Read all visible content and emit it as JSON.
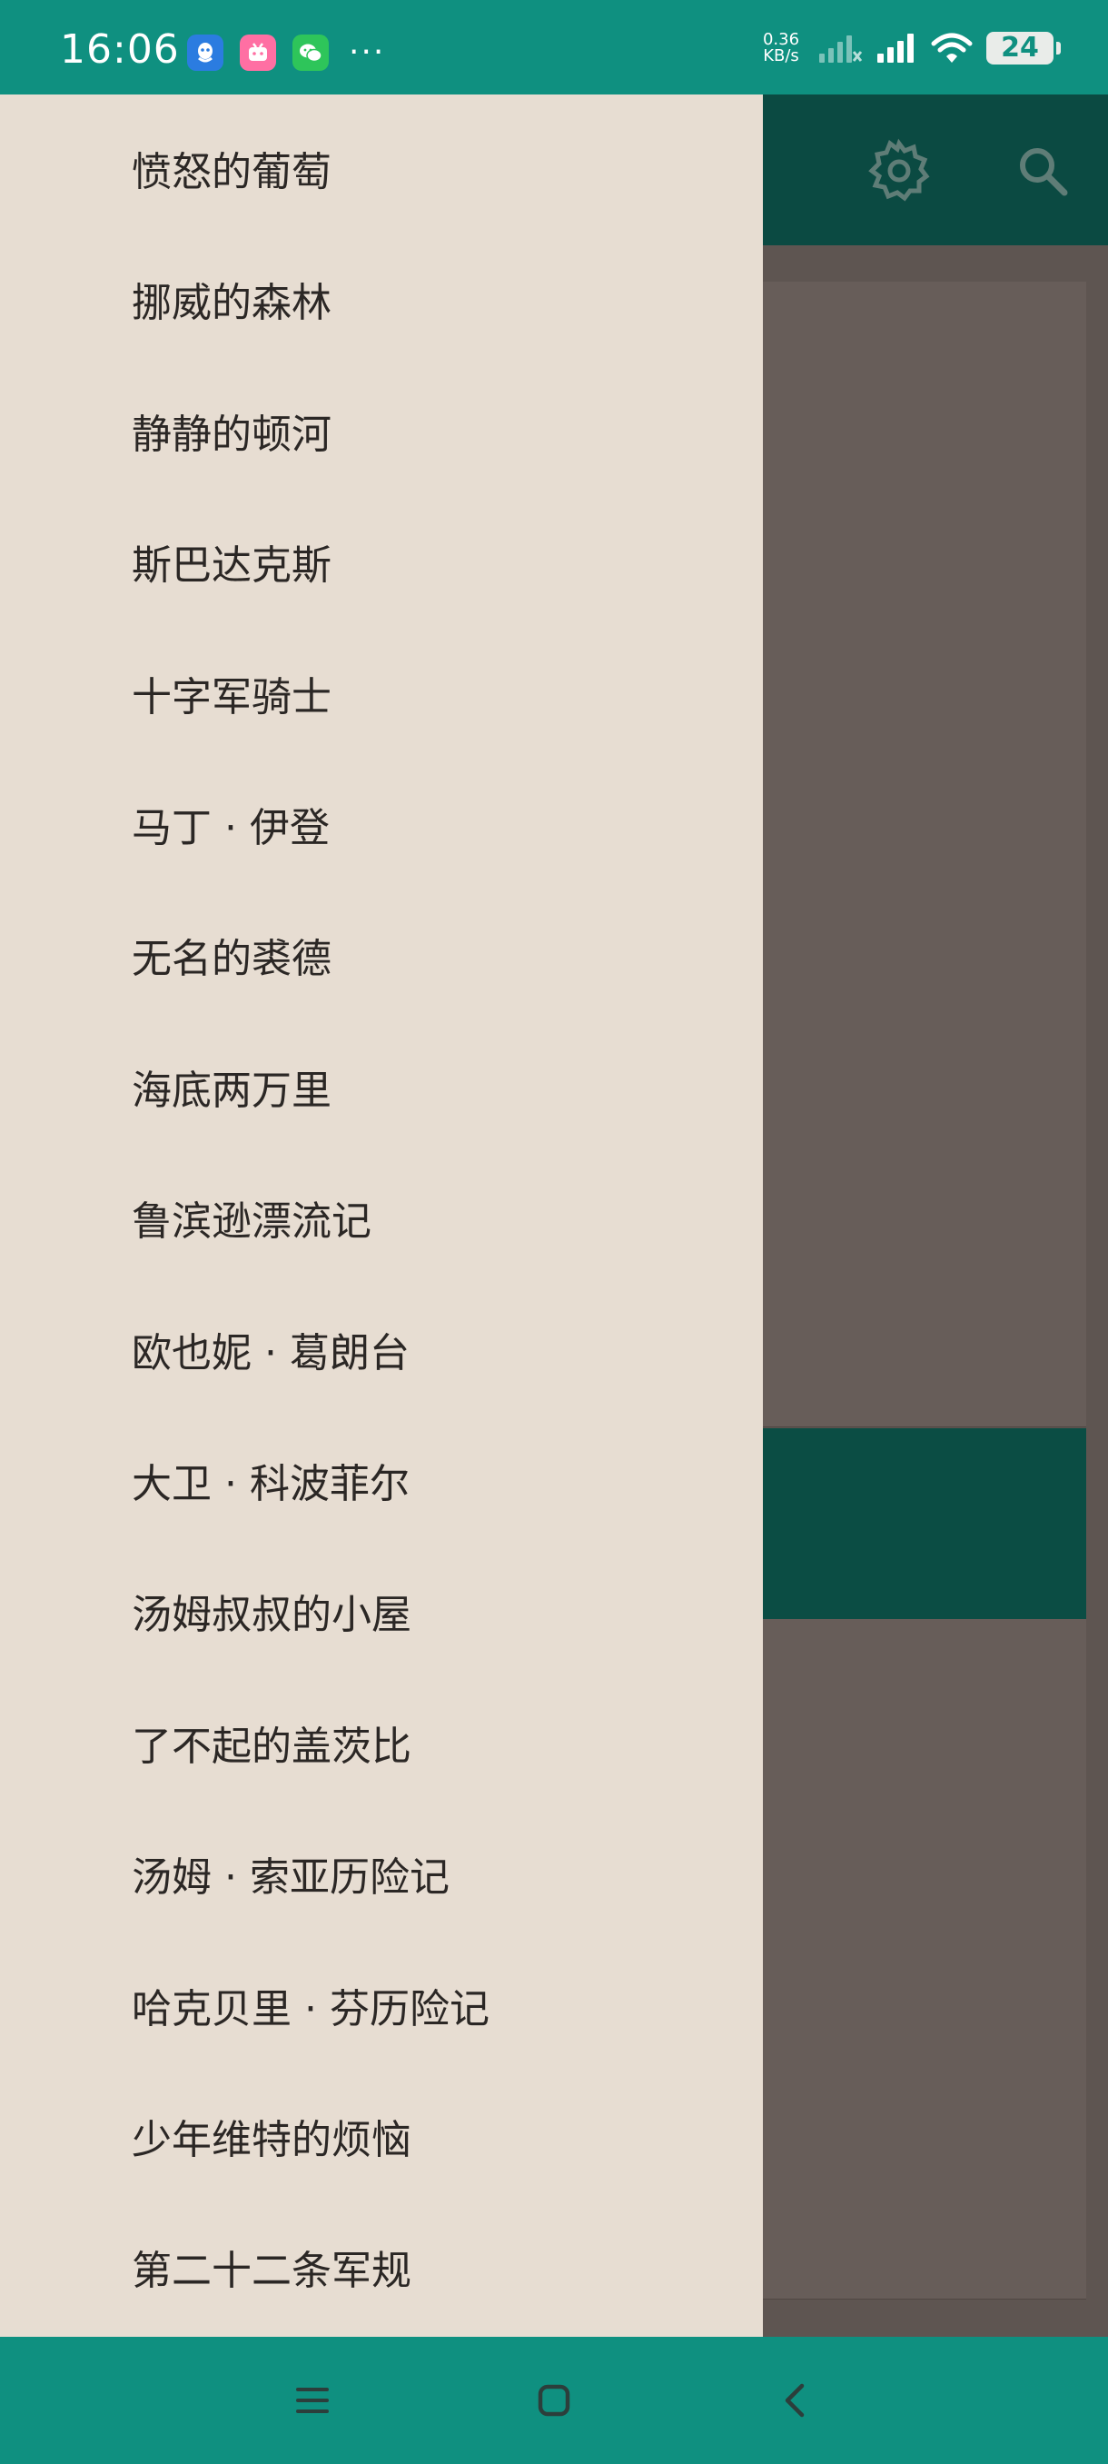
{
  "status_bar": {
    "time": "16:06",
    "net_speed_value": "0.36",
    "net_speed_unit": "KB/s",
    "battery": "24",
    "more": "···"
  },
  "icons": {
    "gear": "gear-icon",
    "search": "search-icon",
    "menu": "menu-icon",
    "home": "home-icon",
    "back": "back-icon"
  },
  "colors": {
    "status_bar": "#0f9080",
    "toolbar": "#0b4a42",
    "drawer": "#e7ddd2"
  },
  "drawer": {
    "items": [
      "愤怒的葡萄",
      "挪威的森林",
      "静静的顿河",
      "斯巴达克斯",
      "十字军骑士",
      "马丁 · 伊登",
      "无名的裘德",
      "海底两万里",
      "鲁滨逊漂流记",
      "欧也妮 · 葛朗台",
      "大卫 · 科波菲尔",
      "汤姆叔叔的小屋",
      "了不起的盖茨比",
      "汤姆 · 索亚历险记",
      "哈克贝里 · 芬历险记",
      "少年维特的烦恼",
      "第二十二条军规"
    ]
  }
}
